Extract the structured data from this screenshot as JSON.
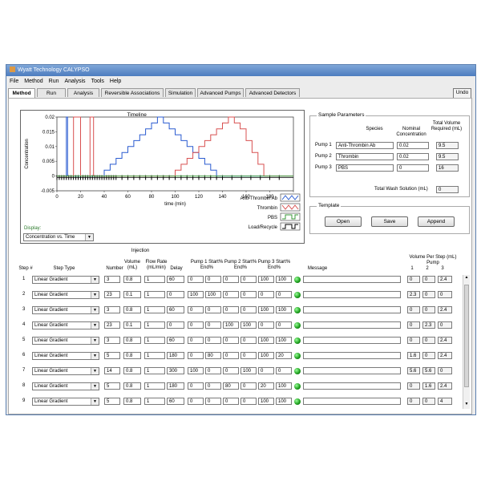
{
  "window": {
    "title": "Wyatt Technology CALYPSO"
  },
  "menu": [
    "File",
    "Method",
    "Run",
    "Analysis",
    "Tools",
    "Help"
  ],
  "tabs": [
    "Method",
    "Run",
    "Analysis",
    "Reversible Associations",
    "Simulation",
    "Advanced Pumps",
    "Advanced Detectors"
  ],
  "undo_label": "Undo",
  "chart_data": {
    "type": "line",
    "title": "Timeline",
    "xlabel": "time (min)",
    "ylabel": "Concentration",
    "xlim": [
      0,
      200
    ],
    "ylim": [
      -0.005,
      0.02
    ],
    "xticks": [
      "0",
      "20",
      "40",
      "60",
      "80",
      "100",
      "120",
      "140",
      "160",
      "180",
      "200"
    ],
    "yticks": [
      "0.02",
      "0.015",
      "0.01",
      "0.005",
      "0",
      "-0.005"
    ],
    "series": [
      {
        "name": "Anti-Thrombin Ab",
        "color": "#2a5bd0",
        "x": [
          0,
          8,
          8,
          9,
          9,
          19,
          19,
          40,
          40,
          45,
          45,
          50,
          50,
          55,
          55,
          60,
          60,
          65,
          65,
          70,
          70,
          75,
          75,
          80,
          80,
          85,
          85,
          90,
          90,
          95,
          95,
          100,
          100,
          105,
          105,
          110,
          110,
          115,
          115,
          120,
          120,
          125,
          125,
          130,
          130,
          135,
          135,
          140,
          140,
          200
        ],
        "y": [
          0,
          0,
          0.02,
          0.02,
          0,
          0,
          0,
          0,
          0.002,
          0.002,
          0.004,
          0.004,
          0.006,
          0.006,
          0.008,
          0.008,
          0.01,
          0.01,
          0.012,
          0.012,
          0.014,
          0.014,
          0.016,
          0.016,
          0.018,
          0.018,
          0.02,
          0.02,
          0.018,
          0.018,
          0.016,
          0.016,
          0.014,
          0.014,
          0.012,
          0.012,
          0.01,
          0.01,
          0.008,
          0.008,
          0.006,
          0.006,
          0.004,
          0.004,
          0.002,
          0.002,
          0.0,
          0.0,
          0,
          0
        ]
      },
      {
        "name": "Thrombin",
        "color": "#d85050",
        "x": [
          0,
          14,
          14,
          20,
          20,
          28,
          28,
          31,
          31,
          100,
          100,
          105,
          105,
          110,
          110,
          115,
          115,
          120,
          120,
          125,
          125,
          130,
          130,
          135,
          135,
          140,
          140,
          145,
          145,
          150,
          150,
          155,
          155,
          160,
          160,
          165,
          165,
          170,
          170,
          175,
          175,
          180,
          180,
          200
        ],
        "y": [
          0,
          0,
          0.02,
          0.02,
          0,
          0,
          0.02,
          0.02,
          0,
          0,
          0.002,
          0.002,
          0.004,
          0.004,
          0.006,
          0.006,
          0.008,
          0.008,
          0.01,
          0.01,
          0.012,
          0.012,
          0.014,
          0.014,
          0.016,
          0.016,
          0.018,
          0.018,
          0.02,
          0.02,
          0.018,
          0.018,
          0.016,
          0.016,
          0.012,
          0.012,
          0.008,
          0.008,
          0.004,
          0.004,
          0.0,
          0.0,
          0,
          0
        ]
      },
      {
        "name": "PBS",
        "color": "#3a9a3a",
        "x": [
          0,
          200
        ],
        "y": [
          0,
          0
        ]
      },
      {
        "name": "Load/Recycle",
        "color": "#000000",
        "x": [
          0,
          200
        ],
        "y": [
          -0.0005,
          -0.0005
        ]
      }
    ]
  },
  "display": {
    "label": "Display:",
    "selected": "Concentration vs. Time"
  },
  "sample": {
    "title": "Sample Parameters",
    "col_species": "Species",
    "col_nominal": "Nominal Concentration",
    "col_total": "Total Volume Required (mL)",
    "pumps": [
      {
        "label": "Pump 1",
        "species": "Anti-Thrombin Ab",
        "conc": "0.02",
        "vol": "9.5"
      },
      {
        "label": "Pump 2",
        "species": "Thrombin",
        "conc": "0.02",
        "vol": "9.5"
      },
      {
        "label": "Pump 3",
        "species": "PBS",
        "conc": "0",
        "vol": "16"
      }
    ],
    "wash_label": "Total Wash Solution (mL)",
    "wash_value": "0"
  },
  "template": {
    "title": "Template",
    "open": "Open",
    "save": "Save",
    "append": "Append"
  },
  "steps_header": {
    "injection": "Injection",
    "step": "Step #",
    "type": "Step Type",
    "number": "Number",
    "volume": "Volume (mL)",
    "flow": "Flow Rate (mL/min)",
    "delay": "Delay",
    "pump1": "Pump 1 Start% End%",
    "pump2": "Pump 2 Start% End%",
    "pump3": "Pump 3 Start% End%",
    "message": "Message",
    "vps": "Volume Per Step (mL)",
    "vps_pump": "Pump",
    "p1": "1",
    "p2": "2",
    "p3": "3"
  },
  "steps": [
    {
      "n": "1",
      "type": "Linear Gradient",
      "num": "3",
      "vol": "0.8",
      "flow": "1",
      "delay": "60",
      "p1s": "0",
      "p1e": "0",
      "p2s": "0",
      "p2e": "0",
      "p3s": "100",
      "p3e": "100",
      "v1": "0",
      "v2": "0",
      "v3": "2.4"
    },
    {
      "n": "2",
      "type": "Linear Gradient",
      "num": "23",
      "vol": "0.1",
      "flow": "1",
      "delay": "0",
      "p1s": "100",
      "p1e": "100",
      "p2s": "0",
      "p2e": "0",
      "p3s": "0",
      "p3e": "0",
      "v1": "2.3",
      "v2": "0",
      "v3": "0"
    },
    {
      "n": "3",
      "type": "Linear Gradient",
      "num": "3",
      "vol": "0.8",
      "flow": "1",
      "delay": "60",
      "p1s": "0",
      "p1e": "0",
      "p2s": "0",
      "p2e": "0",
      "p3s": "100",
      "p3e": "100",
      "v1": "0",
      "v2": "0",
      "v3": "2.4"
    },
    {
      "n": "4",
      "type": "Linear Gradient",
      "num": "23",
      "vol": "0.1",
      "flow": "1",
      "delay": "0",
      "p1s": "0",
      "p1e": "0",
      "p2s": "100",
      "p2e": "100",
      "p3s": "0",
      "p3e": "0",
      "v1": "0",
      "v2": "2.3",
      "v3": "0"
    },
    {
      "n": "5",
      "type": "Linear Gradient",
      "num": "3",
      "vol": "0.8",
      "flow": "1",
      "delay": "60",
      "p1s": "0",
      "p1e": "0",
      "p2s": "0",
      "p2e": "0",
      "p3s": "100",
      "p3e": "100",
      "v1": "0",
      "v2": "0",
      "v3": "2.4"
    },
    {
      "n": "6",
      "type": "Linear Gradient",
      "num": "5",
      "vol": "0.8",
      "flow": "1",
      "delay": "180",
      "p1s": "0",
      "p1e": "80",
      "p2s": "0",
      "p2e": "0",
      "p3s": "100",
      "p3e": "20",
      "v1": "1.6",
      "v2": "0",
      "v3": "2.4"
    },
    {
      "n": "7",
      "type": "Linear Gradient",
      "num": "14",
      "vol": "0.8",
      "flow": "1",
      "delay": "300",
      "p1s": "100",
      "p1e": "0",
      "p2s": "0",
      "p2e": "100",
      "p3s": "0",
      "p3e": "0",
      "v1": "5.6",
      "v2": "5.6",
      "v3": "0"
    },
    {
      "n": "8",
      "type": "Linear Gradient",
      "num": "5",
      "vol": "0.8",
      "flow": "1",
      "delay": "180",
      "p1s": "0",
      "p1e": "0",
      "p2s": "80",
      "p2e": "0",
      "p3s": "20",
      "p3e": "100",
      "v1": "0",
      "v2": "1.6",
      "v3": "2.4"
    },
    {
      "n": "9",
      "type": "Linear Gradient",
      "num": "5",
      "vol": "0.8",
      "flow": "1",
      "delay": "60",
      "p1s": "0",
      "p1e": "0",
      "p2s": "0",
      "p2e": "0",
      "p3s": "100",
      "p3e": "100",
      "v1": "0",
      "v2": "0",
      "v3": "4"
    }
  ]
}
